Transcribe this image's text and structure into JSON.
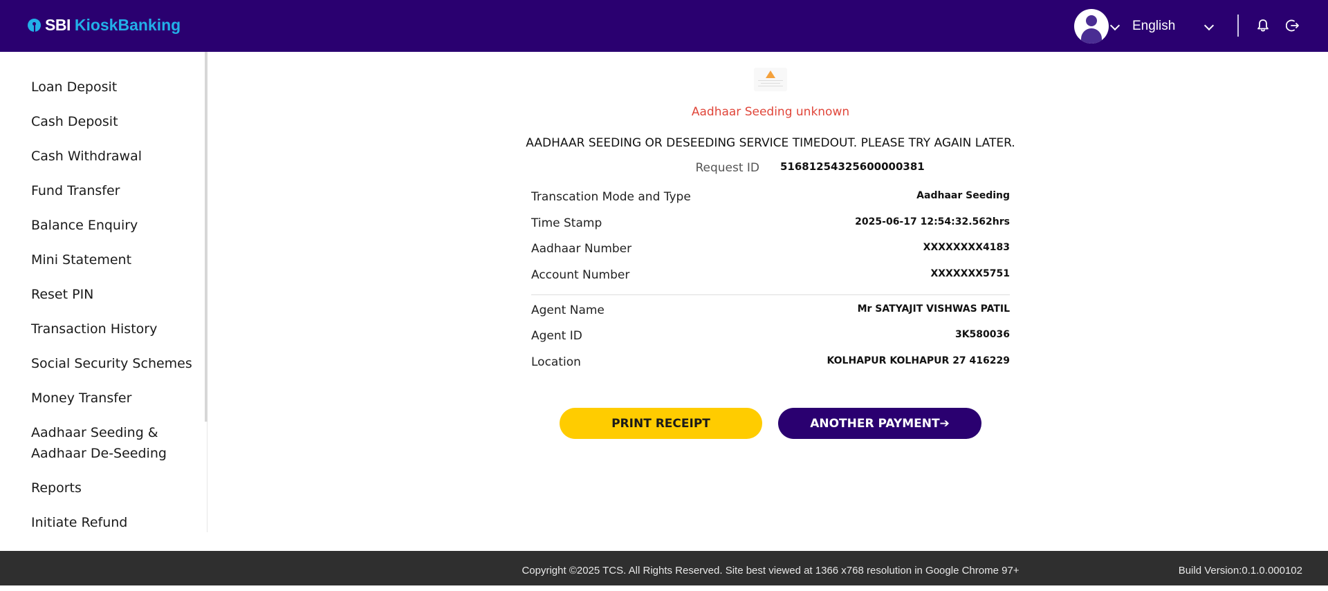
{
  "header": {
    "brand_prefix": "SBI",
    "brand_name": "KioskBanking",
    "language": "English",
    "colors": {
      "background": "#2a0070",
      "brand_accent": "#22b0e8"
    },
    "icons": [
      "sbi-logo-icon",
      "user-avatar-icon",
      "chevron-down-icon",
      "bell-icon",
      "logout-icon"
    ]
  },
  "sidebar": {
    "items": [
      {
        "label": "Loan Deposit"
      },
      {
        "label": "Cash Deposit"
      },
      {
        "label": "Cash Withdrawal"
      },
      {
        "label": "Fund Transfer"
      },
      {
        "label": "Balance Enquiry"
      },
      {
        "label": "Mini Statement"
      },
      {
        "label": "Reset PIN"
      },
      {
        "label": "Transaction History"
      },
      {
        "label": "Social Security Schemes"
      },
      {
        "label": "Money Transfer"
      },
      {
        "label": "Aadhaar Seeding &",
        "label_line2": "Aadhaar De-Seeding"
      },
      {
        "label": "Reports"
      },
      {
        "label": "Initiate Refund"
      }
    ]
  },
  "receipt": {
    "status_title": "Aadhaar Seeding unknown",
    "status_message": "AADHAAR SEEDING OR DESEEDING SERVICE TIMEDOUT. PLEASE TRY AGAIN LATER.",
    "request_id_label": "Request ID",
    "request_id_value": "51681254325600000381",
    "rows": [
      {
        "label": "Transcation Mode and Type",
        "value": "Aadhaar Seeding"
      },
      {
        "label": "Time Stamp",
        "value": "2025-06-17 12:54:32.562hrs"
      },
      {
        "label": "Aadhaar Number",
        "value": "XXXXXXXX4183"
      },
      {
        "label": "Account Number",
        "value": "XXXXXXX5751"
      }
    ],
    "agent_rows": [
      {
        "label": "Agent Name",
        "value": "Mr SATYAJIT VISHWAS PATIL"
      },
      {
        "label": "Agent ID",
        "value": "3K580036"
      },
      {
        "label": "Location",
        "value": "KOLHAPUR KOLHAPUR 27 416229"
      }
    ],
    "colors": {
      "status_title": "#e0463a"
    }
  },
  "actions": {
    "print_label": "PRINT RECEIPT",
    "another_label": "ANOTHER PAYMENT➔",
    "colors": {
      "print": "#ffcc00",
      "another": "#2a0070"
    }
  },
  "footer": {
    "copyright": "Copyright ©2025 TCS. All Rights Reserved. Site best viewed at 1366 x768 resolution in Google Chrome 97+",
    "build_version": "Build Version:0.1.0.000102"
  }
}
